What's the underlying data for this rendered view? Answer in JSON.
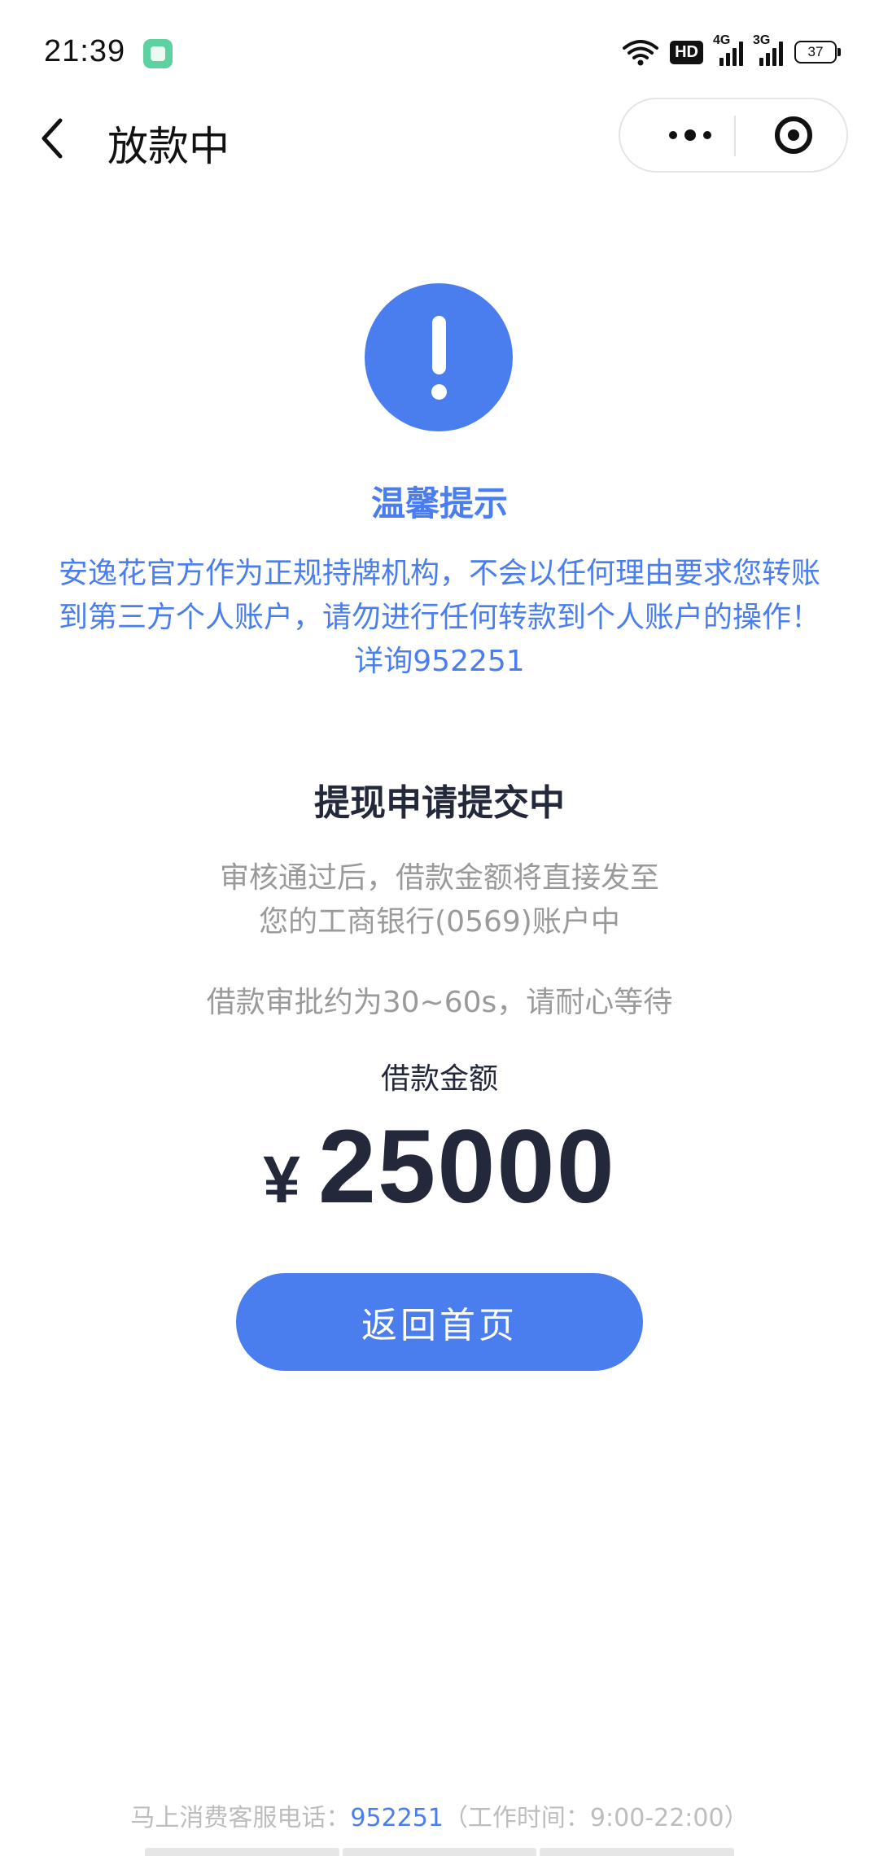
{
  "status_bar": {
    "time": "21:39",
    "hd_label": "HD",
    "signal1_label": "4G",
    "signal2_label": "3G",
    "battery": "37"
  },
  "nav": {
    "title": "放款中"
  },
  "notice": {
    "title": "温馨提示",
    "body": "安逸花官方作为正规持牌机构，不会以任何理由要求您转账到第三方个人账户，请勿进行任何转款到个人账户的操作！详询952251"
  },
  "status": {
    "title": "提现申请提交中",
    "line1": "审核通过后，借款金额将直接发至",
    "line2": "您的工商银行(0569)账户中",
    "wait_note": "借款审批约为30~60s，请耐心等待"
  },
  "loan": {
    "label": "借款金额",
    "currency": "¥",
    "amount": "25000"
  },
  "actions": {
    "home_button": "返回首页"
  },
  "footer": {
    "prefix": "马上消费客服电话：",
    "phone": "952251",
    "hours": "（工作时间：9:00-22:00）"
  },
  "colors": {
    "accent": "#4a7ded",
    "dark_text": "#23293a",
    "muted_text": "#9a9a9a"
  }
}
